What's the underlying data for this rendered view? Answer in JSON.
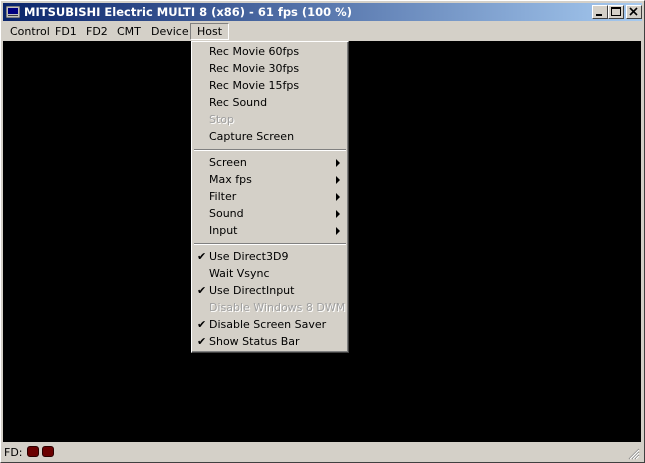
{
  "window": {
    "title": "MITSUBISHI Electric MULTI 8 (x86) - 61 fps (100 %)"
  },
  "menubar": {
    "items": [
      "Control",
      "FD1",
      "FD2",
      "CMT",
      "Device",
      "Host"
    ],
    "active": "Host"
  },
  "host_menu": {
    "recording": [
      {
        "label": "Rec Movie 60fps",
        "enabled": true
      },
      {
        "label": "Rec Movie 30fps",
        "enabled": true
      },
      {
        "label": "Rec Movie 15fps",
        "enabled": true
      },
      {
        "label": "Rec Sound",
        "enabled": true
      },
      {
        "label": "Stop",
        "enabled": false
      },
      {
        "label": "Capture Screen",
        "enabled": true
      }
    ],
    "submenus": [
      {
        "label": "Screen"
      },
      {
        "label": "Max fps"
      },
      {
        "label": "Filter"
      },
      {
        "label": "Sound"
      },
      {
        "label": "Input"
      }
    ],
    "options": [
      {
        "label": "Use Direct3D9",
        "checked": true,
        "enabled": true
      },
      {
        "label": "Wait Vsync",
        "checked": false,
        "enabled": true
      },
      {
        "label": "Use DirectInput",
        "checked": true,
        "enabled": true
      },
      {
        "label": "Disable Windows 8 DWM",
        "checked": false,
        "enabled": false
      },
      {
        "label": "Disable Screen Saver",
        "checked": true,
        "enabled": true
      },
      {
        "label": "Show Status Bar",
        "checked": true,
        "enabled": true
      }
    ]
  },
  "statusbar": {
    "label": "FD:",
    "led_color": "#6a0000"
  },
  "colors": {
    "titlebar_start": "#0a246a",
    "titlebar_end": "#a6caf0",
    "face": "#d4d0c8",
    "screen": "#000000"
  }
}
